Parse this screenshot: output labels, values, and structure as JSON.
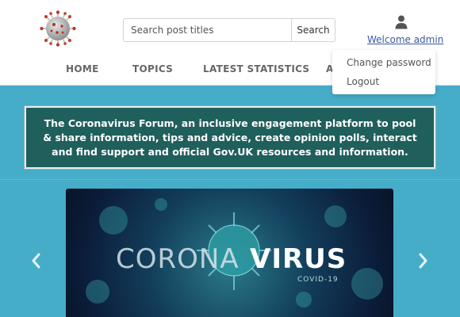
{
  "search": {
    "placeholder": "Search post titles",
    "button_label": "Search"
  },
  "user": {
    "welcome_label": "Welcome admin",
    "icon": "user-icon"
  },
  "nav": {
    "items": [
      "HOME",
      "TOPICS",
      "LATEST STATISTICS",
      "A"
    ]
  },
  "dropdown": {
    "items": [
      "Change password",
      "Logout"
    ]
  },
  "banner": {
    "text": "The Coronavirus Forum, an inclusive engagement platform to pool & share information, tips and advice, create opinion polls, interact and find support and official Gov.UK resources and information."
  },
  "carousel": {
    "slide_text_light": "CORONA",
    "slide_text_bold": "VIRUS",
    "slide_subtext": "COVID-19",
    "prev_icon": "chevron-left-icon",
    "next_icon": "chevron-right-icon"
  },
  "colors": {
    "page_bg": "#46adc9",
    "banner_bg": "#1f5f5c",
    "link": "#3a5aa0"
  }
}
